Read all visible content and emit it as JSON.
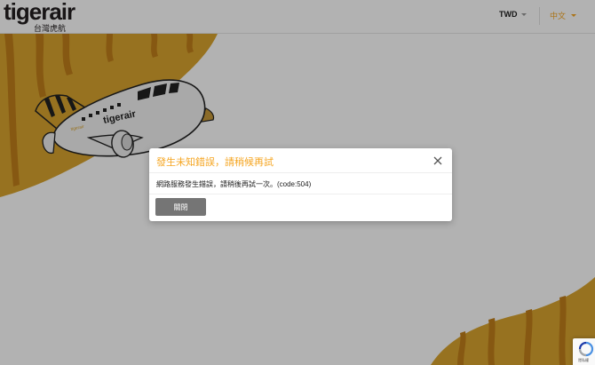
{
  "header": {
    "logo_text": "tigerair",
    "logo_subtext": "台灣虎航",
    "currency": "TWD",
    "language": "中文"
  },
  "plane": {
    "livery_text": "tigerair",
    "tail_text": "tigerair"
  },
  "modal": {
    "title": "發生未知錯誤，請稍候再試",
    "message": "網路服務發生錯誤，請稍後再試一次。(code:504)",
    "close_button_label": "關閉"
  },
  "recaptcha": {
    "text": "隱私權"
  },
  "colors": {
    "brand_orange": "#f5a623",
    "tiger_gold": "#d9a42e",
    "tiger_stripe": "#c17f1b",
    "button_gray": "#757575"
  }
}
